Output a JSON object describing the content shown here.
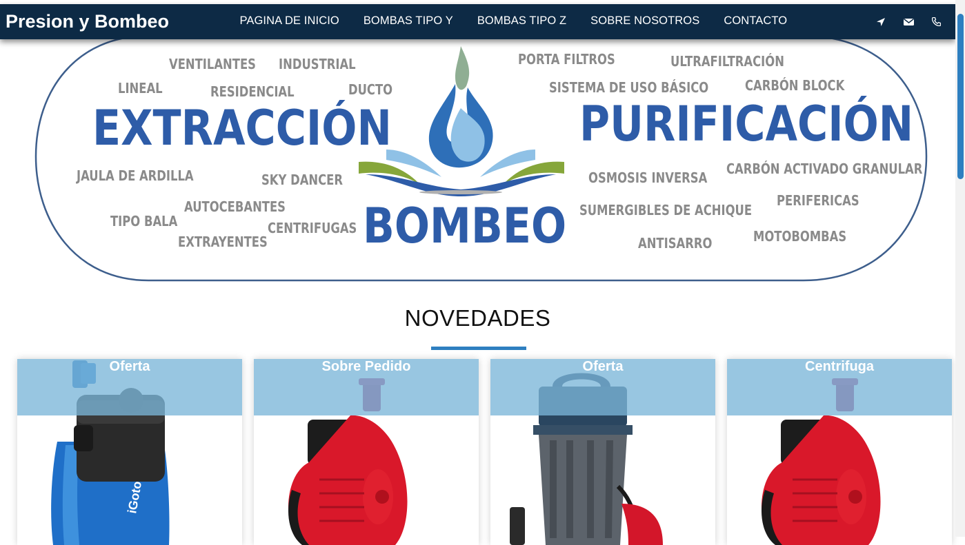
{
  "brand": {
    "name": "Presion y Bombeo"
  },
  "nav": {
    "items": [
      {
        "label": "PAGINA DE INICIO"
      },
      {
        "label": "BOMBAS TIPO Y"
      },
      {
        "label": "BOMBAS TIPO Z"
      },
      {
        "label": "SOBRE NOSOTROS"
      },
      {
        "label": "CONTACTO"
      }
    ],
    "icons": [
      "location-arrow-icon",
      "envelope-icon",
      "phone-icon"
    ]
  },
  "hero": {
    "left_title": "EXTRACCIÓN",
    "right_title": "PURIFICACIÓN",
    "center_title": "BOMBEO",
    "left_words": [
      "VENTILANTES",
      "INDUSTRIAL",
      "LINEAL",
      "RESIDENCIAL",
      "DUCTO",
      "JAULA DE ARDILLA",
      "SKY DANCER",
      "AUTOCEBANTES",
      "TIPO BALA",
      "CENTRIFUGAS",
      "EXTRAYENTES"
    ],
    "right_words": [
      "PORTA FILTROS",
      "ULTRAFILTRACIÓN",
      "SISTEMA DE USO BÁSICO",
      "CARBÓN BLOCK",
      "OSMOSIS INVERSA",
      "CARBÓN ACTIVADO GRANULAR",
      "SUMERGIBLES DE ACHIQUE",
      "PERIFERICAS",
      "ANTISARRO",
      "MOTOBOMBAS"
    ],
    "colors": {
      "title": "#2e5ca8",
      "words": "#8a8a8a",
      "oval": "#3d5e8c"
    }
  },
  "section": {
    "title": "NOVEDADES"
  },
  "products": [
    {
      "label": "Oferta"
    },
    {
      "label": "Sobre Pedido"
    },
    {
      "label": "Oferta"
    },
    {
      "label": "Centrifuga"
    }
  ],
  "colors": {
    "navbar": "#0d2a45",
    "accent": "#2e7fc0",
    "card_band": "#7bb6d8"
  }
}
